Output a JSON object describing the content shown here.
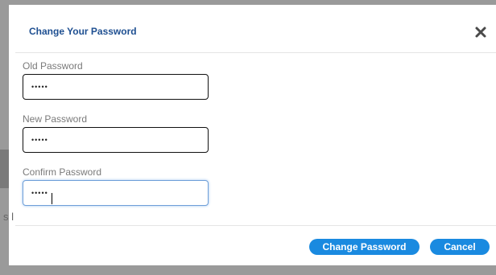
{
  "modal": {
    "title": "Change Your Password",
    "close_icon": "close-icon"
  },
  "fields": {
    "old_password": {
      "label": "Old Password",
      "value": "•••••"
    },
    "new_password": {
      "label": "New Password",
      "value": "•••••"
    },
    "confirm_password": {
      "label": "Confirm Password",
      "value": "•••••"
    }
  },
  "buttons": {
    "change_password": "Change Password",
    "cancel": "Cancel"
  },
  "background": {
    "fragment_text": "s l"
  },
  "colors": {
    "title": "#1e4f91",
    "button": "#1a8ae0",
    "focus_border": "#6f9fd8"
  }
}
